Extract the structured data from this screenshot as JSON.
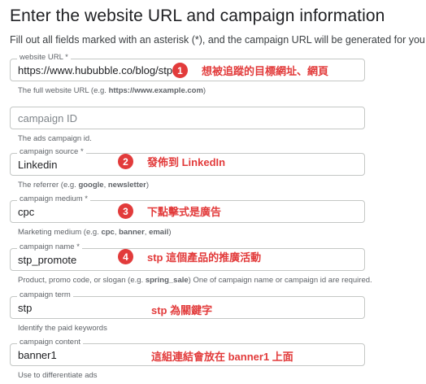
{
  "header": {
    "title": "Enter the website URL and campaign information",
    "subtitle": "Fill out all fields marked with an asterisk (*), and the campaign URL will be generated for you."
  },
  "fields": {
    "website_url": {
      "label": "website URL *",
      "value": "https://www.hububble.co/blog/stp",
      "helper_pre": "The full website URL (e.g. ",
      "helper_bold": "https://www.example.com",
      "helper_post": ")"
    },
    "campaign_id": {
      "placeholder": "campaign ID",
      "helper": "The ads campaign id."
    },
    "campaign_source": {
      "label": "campaign source *",
      "value": "Linkedin",
      "helper_pre": "The referrer (e.g. ",
      "helper_bold1": "google",
      "helper_mid": ", ",
      "helper_bold2": "newsletter",
      "helper_post": ")"
    },
    "campaign_medium": {
      "label": "campaign medium *",
      "value": "cpc",
      "helper_pre": "Marketing medium (e.g. ",
      "helper_bold1": "cpc",
      "helper_mid1": ", ",
      "helper_bold2": "banner",
      "helper_mid2": ", ",
      "helper_bold3": "email",
      "helper_post": ")"
    },
    "campaign_name": {
      "label": "campaign name *",
      "value": "stp_promote",
      "helper_pre": "Product, promo code, or slogan (e.g. ",
      "helper_bold": "spring_sale",
      "helper_post": ") One of campaign name or campaign id are required."
    },
    "campaign_term": {
      "label": "campaign term",
      "value": "stp",
      "helper": "Identify the paid keywords"
    },
    "campaign_content": {
      "label": "campaign content",
      "value": "banner1",
      "helper": "Use to differentiate ads"
    }
  },
  "annotations": [
    {
      "number": "1",
      "text": "想被追蹤的目標網址、網頁"
    },
    {
      "number": "2",
      "text": "發佈到 LinkedIn"
    },
    {
      "number": "3",
      "text": "下點擊式是廣告"
    },
    {
      "number": "4",
      "text": "stp 這個產品的推廣活動"
    },
    {
      "text": "stp 為關鍵字"
    },
    {
      "text": "這組連結會放在 banner1 上面"
    }
  ],
  "colors": {
    "annotation_red": "#e23b3b",
    "field_border": "#c4c7c5",
    "text": "#202124",
    "helper_text": "#5f6368"
  }
}
